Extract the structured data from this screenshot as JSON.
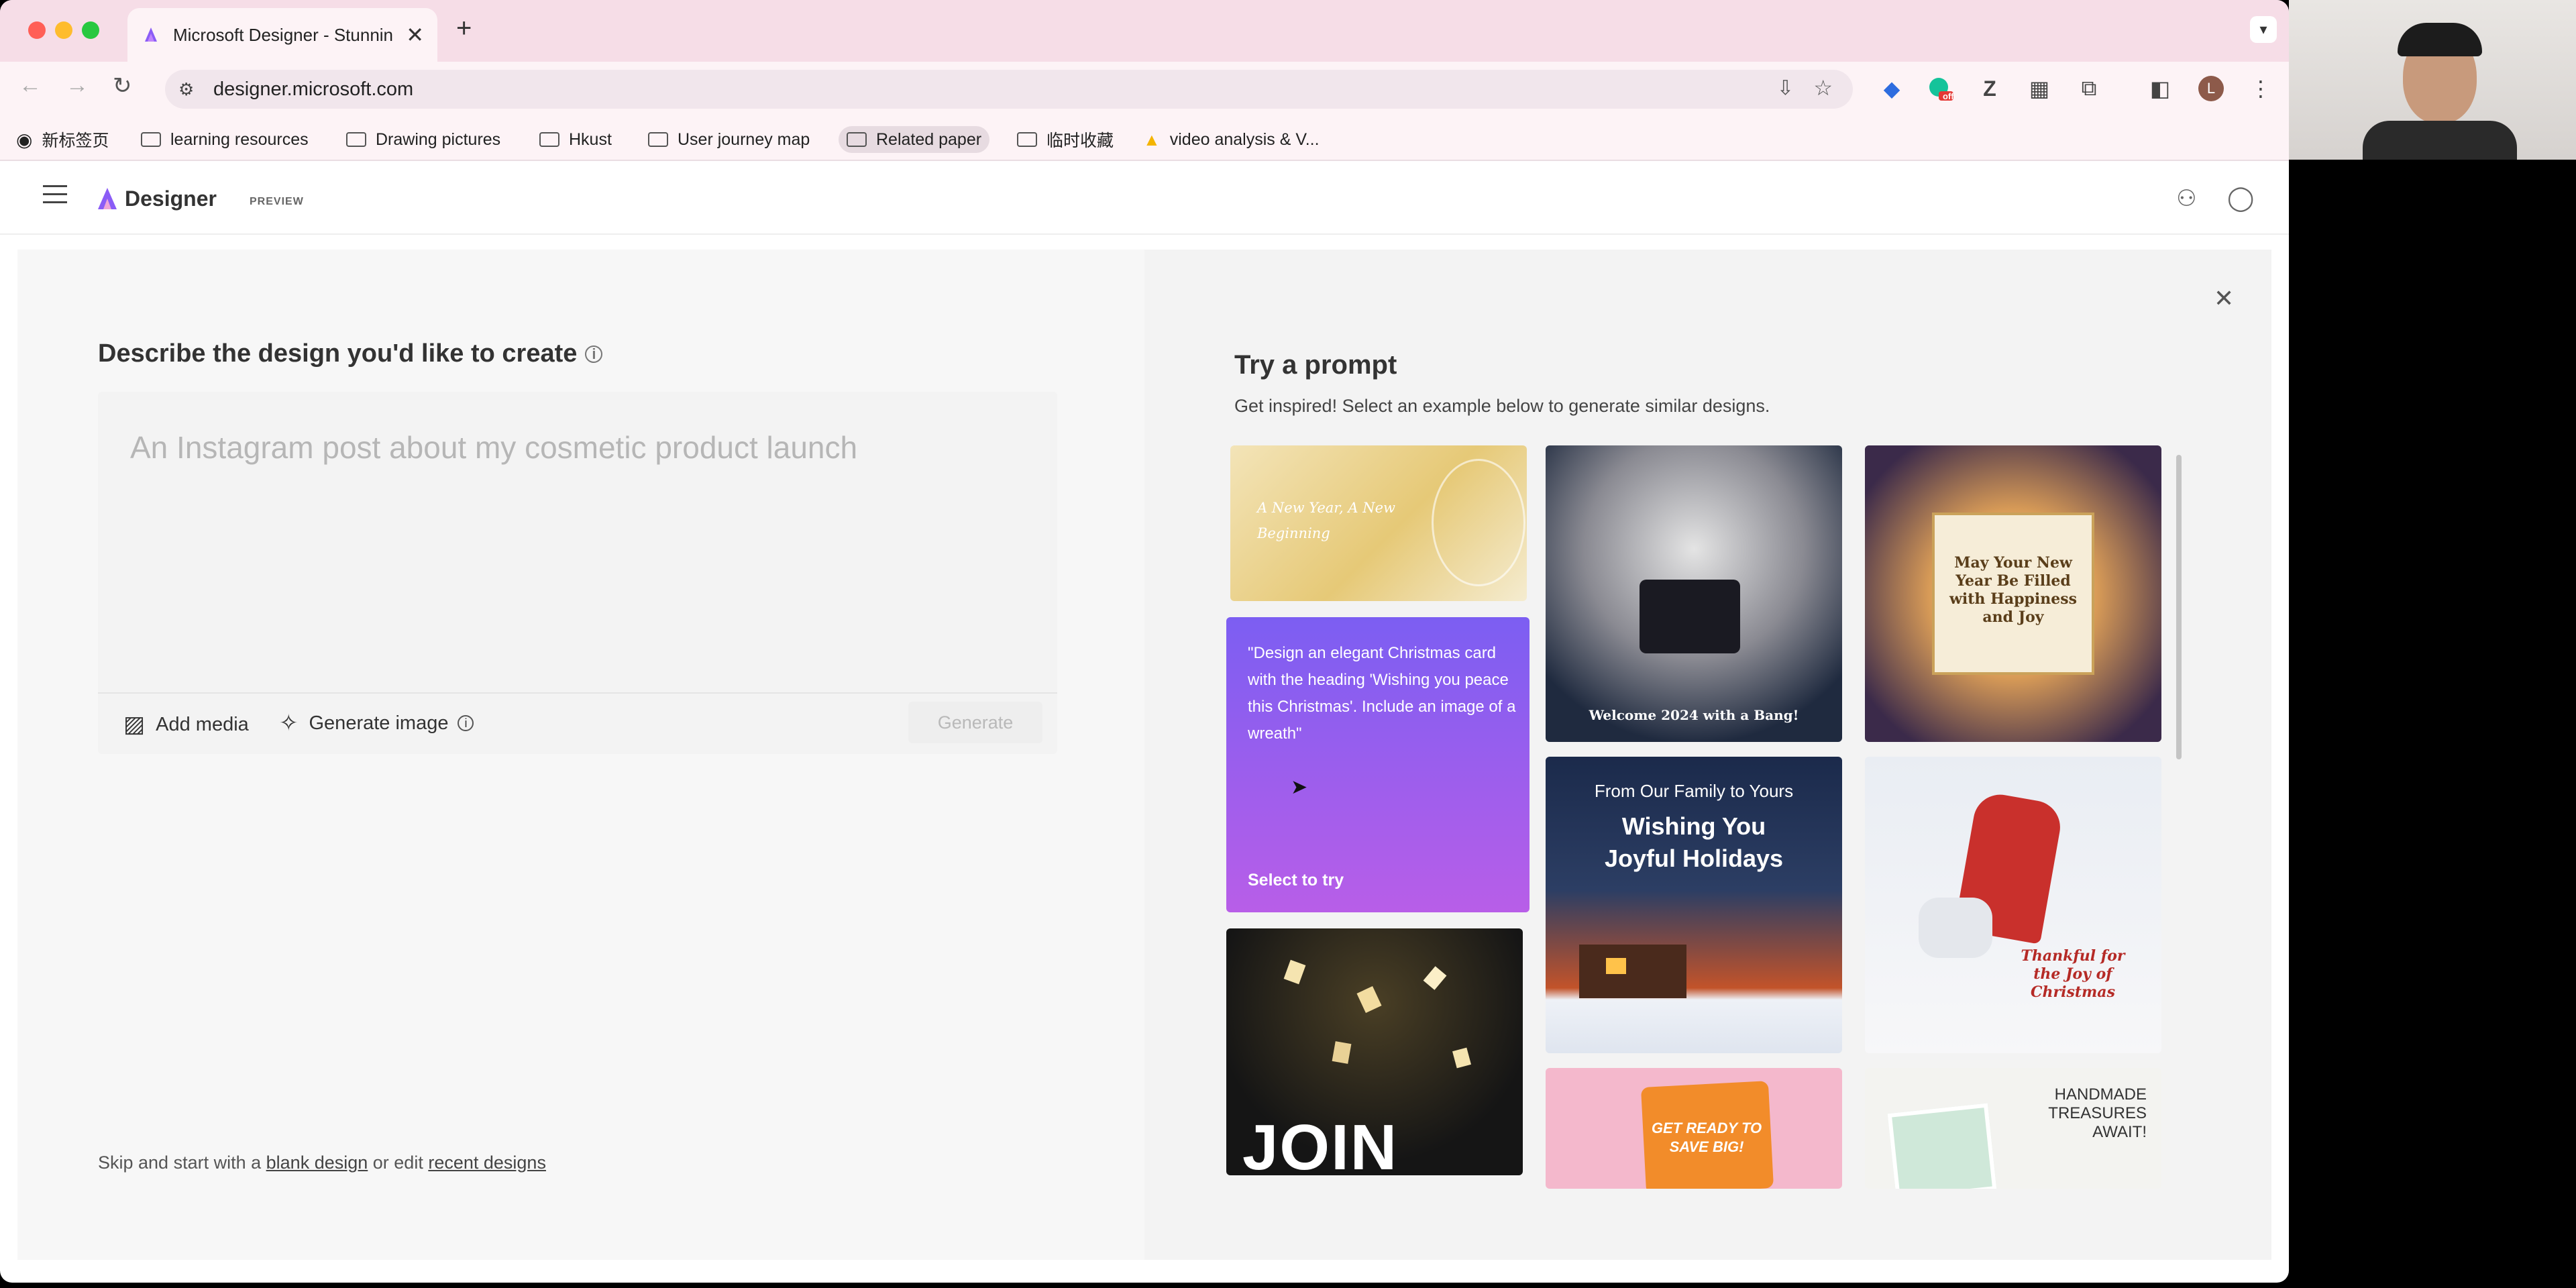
{
  "browser": {
    "tab_title": "Microsoft Designer - Stunnin",
    "url": "designer.microsoft.com",
    "extension_badge": "off",
    "profile_initial": "L",
    "bookmarks": [
      {
        "label": "新标签页",
        "icon": "globe-icon"
      },
      {
        "label": "learning resources",
        "icon": "folder-icon"
      },
      {
        "label": "Drawing pictures",
        "icon": "folder-icon"
      },
      {
        "label": "Hkust",
        "icon": "folder-icon"
      },
      {
        "label": "User journey map",
        "icon": "folder-icon"
      },
      {
        "label": "Related paper",
        "icon": "folder-icon"
      },
      {
        "label": "临时收藏",
        "icon": "folder-icon"
      },
      {
        "label": "video analysis & V...",
        "icon": "google-drive-icon"
      }
    ]
  },
  "app": {
    "name": "Designer",
    "badge": "PREVIEW"
  },
  "create": {
    "heading": "Describe the design you'd like to create",
    "placeholder": "An Instagram post about my cosmetic product launch",
    "add_media": "Add media",
    "generate_image": "Generate image",
    "generate": "Generate",
    "footer_prefix": "Skip and start with a",
    "blank_design": "blank design",
    "footer_mid": "or edit",
    "recent_designs": "recent designs"
  },
  "inspire": {
    "heading": "Try a prompt",
    "subheading": "Get inspired! Select an example below to generate similar designs.",
    "hover_card": {
      "prompt": "\"Design an elegant Christmas card with the heading 'Wishing you peace this Christmas'. Include an image of a wreath\"",
      "cta": "Select to try"
    },
    "tiles": {
      "new_year_gold": "A New Year, A New Beginning",
      "welcome_2024": "Welcome 2024 with a Bang!",
      "may_new_year": "May Your New Year Be Filled with Happiness and Joy",
      "family_top": "From Our Family to Yours",
      "family_main": "Wishing You Joyful Holidays",
      "thankful": "Thankful for the Joy of Christmas",
      "join": "JOIN THE",
      "get_ready": "GET READY TO SAVE BIG!",
      "handmade": "HANDMADE TREASURES AWAIT!"
    }
  },
  "colors": {
    "tab_strip": "#f6dde7",
    "hover_card_top": "#7e5cf0",
    "hover_card_bottom": "#b45ee6",
    "accent": "#7a5af8"
  }
}
